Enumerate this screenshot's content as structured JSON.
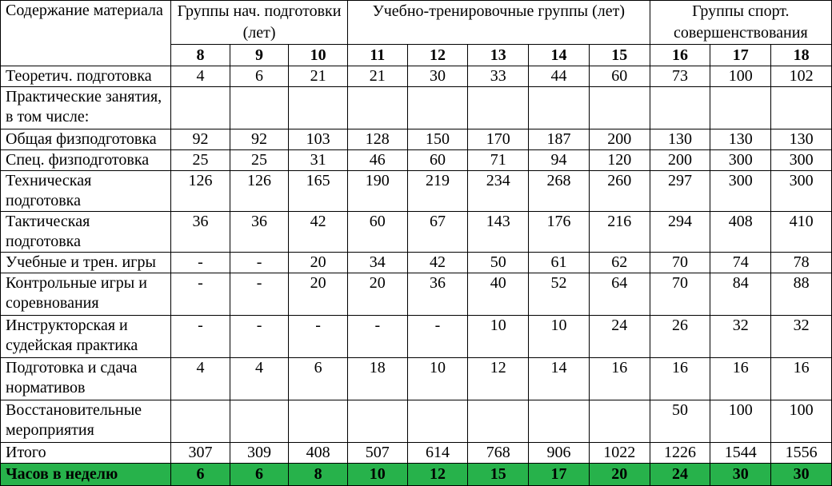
{
  "table": {
    "header": {
      "content_label": "Содержание материала",
      "groups": [
        "Группы нач. подготовки (лет)",
        "Учебно-тренировочные группы (лет)",
        "Группы спорт. совершенствования"
      ],
      "ages": [
        "8",
        "9",
        "10",
        "11",
        "12",
        "13",
        "14",
        "15",
        "16",
        "17",
        "18"
      ]
    },
    "rows": [
      {
        "label": "Теоретич. подготовка",
        "values": [
          "4",
          "6",
          "21",
          "21",
          "30",
          "33",
          "44",
          "60",
          "73",
          "100",
          "102"
        ]
      },
      {
        "label": "Практические занятия, в том числе:",
        "values": [
          "",
          "",
          "",
          "",
          "",
          "",
          "",
          "",
          "",
          "",
          ""
        ]
      },
      {
        "label": "Общая физподготовка",
        "values": [
          "92",
          "92",
          "103",
          "128",
          "150",
          "170",
          "187",
          "200",
          "130",
          "130",
          "130"
        ]
      },
      {
        "label": "Спец. физподготовка",
        "values": [
          "25",
          "25",
          "31",
          "46",
          "60",
          "71",
          "94",
          "120",
          "200",
          "300",
          "300"
        ]
      },
      {
        "label": "Техническая подготовка",
        "values": [
          "126",
          "126",
          "165",
          "190",
          "219",
          "234",
          "268",
          "260",
          "297",
          "300",
          "300"
        ]
      },
      {
        "label": "Тактическая подготовка",
        "values": [
          "36",
          "36",
          "42",
          "60",
          "67",
          "143",
          "176",
          "216",
          "294",
          "408",
          "410"
        ]
      },
      {
        "label": "Учебные и трен. игры",
        "values": [
          "-",
          "-",
          "20",
          "34",
          "42",
          "50",
          "61",
          "62",
          "70",
          "74",
          "78"
        ]
      },
      {
        "label": "Контрольные игры и соревнования",
        "values": [
          "-",
          "-",
          "20",
          "20",
          "36",
          "40",
          "52",
          "64",
          "70",
          "84",
          "88"
        ]
      },
      {
        "label": "Инструкторская и судейская практика",
        "values": [
          "-",
          "-",
          "-",
          "-",
          "-",
          "10",
          "10",
          "24",
          "26",
          "32",
          "32"
        ]
      },
      {
        "label": "Подготовка и сдача нормативов",
        "values": [
          "4",
          "4",
          "6",
          "18",
          "10",
          "12",
          "14",
          "16",
          "16",
          "16",
          "16"
        ]
      },
      {
        "label": "Восстановительные мероприятия",
        "values": [
          "",
          "",
          "",
          "",
          "",
          "",
          "",
          "",
          "50",
          "100",
          "100"
        ]
      },
      {
        "label": "Итого",
        "values": [
          "307",
          "309",
          "408",
          "507",
          "614",
          "768",
          "906",
          "1022",
          "1226",
          "1544",
          "1556"
        ]
      },
      {
        "label": "Часов в неделю",
        "values": [
          "6",
          "6",
          "8",
          "10",
          "12",
          "15",
          "17",
          "20",
          "24",
          "30",
          "30"
        ]
      }
    ],
    "highlight_color": "#27b24b"
  }
}
